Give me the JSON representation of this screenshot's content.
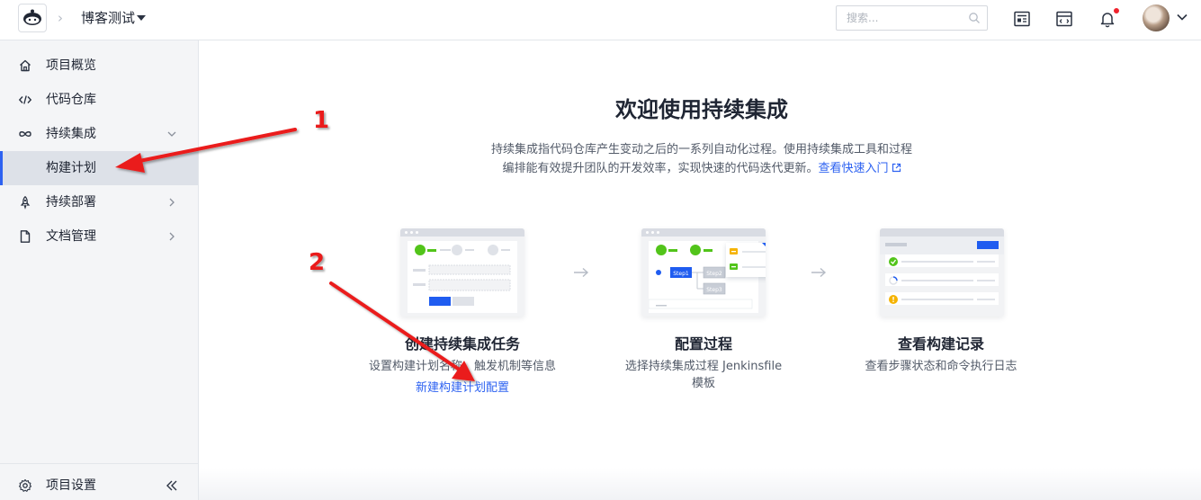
{
  "header": {
    "project_name": "博客测试",
    "search_placeholder": "搜索..."
  },
  "sidebar": {
    "items": [
      {
        "label": "项目概览",
        "icon": "home-icon"
      },
      {
        "label": "代码仓库",
        "icon": "code-icon"
      },
      {
        "label": "持续集成",
        "icon": "infinity-icon",
        "expanded": true
      },
      {
        "label": "构建计划",
        "active": true
      },
      {
        "label": "持续部署",
        "icon": "rocket-icon"
      },
      {
        "label": "文档管理",
        "icon": "document-icon"
      }
    ],
    "footer_label": "项目设置"
  },
  "main": {
    "title": "欢迎使用持续集成",
    "desc_line1": "持续集成指代码仓库产生变动之后的一系列自动化过程。使用持续集成工具和过程",
    "desc_line2": "编排能有效提升团队的开发效率，实现快速的代码迭代更新。",
    "desc_link": "查看快速入门",
    "steps": [
      {
        "title": "创建持续集成任务",
        "desc": "设置构建计划名称、触发机制等信息",
        "link": "新建构建计划配置"
      },
      {
        "title": "配置过程",
        "desc_line1": "选择持续集成过程 Jenkinsfile",
        "desc_line2": "模板"
      },
      {
        "title": "查看构建记录",
        "desc": "查看步骤状态和命令执行日志"
      }
    ],
    "illustration": {
      "step1": "Step1",
      "step2": "Step2",
      "step3": "Step3"
    }
  },
  "annotations": [
    {
      "label": "1"
    },
    {
      "label": "2"
    }
  ],
  "colors": {
    "accent": "#2d62f1",
    "success": "#52c41a",
    "warning": "#f5b300",
    "annotation": "#ea1b1b"
  }
}
